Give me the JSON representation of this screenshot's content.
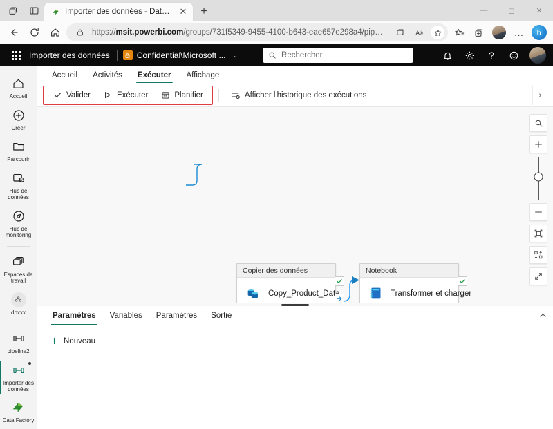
{
  "browser": {
    "tab": {
      "title": "Importer des données - Data Factory",
      "favicon_name": "data-factory-icon",
      "close_label": "✕"
    },
    "newtab_label": "+",
    "window_controls": {
      "minimize": "—",
      "maximize": "◻",
      "close": "✕"
    },
    "nav": {
      "back_label": "←",
      "refresh_label": "⟳",
      "home_label": "⌂",
      "url_prefix": "https://",
      "url_domain": "msit.powerbi.com",
      "url_rest": "/groups/731f5349-9455-4100-b643-eae657e298a4/pip…",
      "read_aloud_label": "A",
      "favorite_label": "☆",
      "favorites_bar_label": "☆",
      "collections_label": "▣",
      "profile_label": "profile",
      "more_label": "…",
      "copilot_label": "b"
    }
  },
  "pbi_header": {
    "waffle_name": "app-launcher",
    "app_title": "Importer des données",
    "sensitivity_label": "Confidential\\Microsoft ...",
    "sensitivity_chevron": "⌄",
    "search_placeholder": "Rechercher",
    "search_icon": "search-icon",
    "icons": {
      "notifications": "bell-icon",
      "settings": "gear-icon",
      "help": "?",
      "feedback": "smiley-icon"
    }
  },
  "rail": {
    "items": [
      {
        "label": "Accueil",
        "icon": "home-icon",
        "selected": false
      },
      {
        "label": "Créer",
        "icon": "plus-circle-icon",
        "selected": false
      },
      {
        "label": "Parcourir",
        "icon": "folder-icon",
        "selected": false
      },
      {
        "label": "Hub de données",
        "icon": "database-icon",
        "selected": false
      },
      {
        "label": "Hub de monitoring",
        "icon": "monitoring-icon",
        "selected": false
      },
      {
        "label": "Espaces de travail",
        "icon": "workspaces-icon",
        "selected": false
      },
      {
        "label": "dpxxx",
        "icon": "workspace-avatar-icon",
        "selected": false
      },
      {
        "label": "pipeline2",
        "icon": "pipeline-icon",
        "selected": false
      },
      {
        "label": "Importer des données",
        "icon": "pipeline-icon",
        "selected": true
      }
    ],
    "footer": {
      "label": "Data Factory",
      "icon": "data-factory-icon"
    }
  },
  "ribbon": {
    "tabs": [
      {
        "label": "Accueil",
        "active": false
      },
      {
        "label": "Activités",
        "active": false
      },
      {
        "label": "Exécuter",
        "active": true
      },
      {
        "label": "Affichage",
        "active": false
      }
    ],
    "group_buttons": [
      {
        "label": "Valider",
        "icon": "checkmark-icon"
      },
      {
        "label": "Exécuter",
        "icon": "play-icon"
      },
      {
        "label": "Planifier",
        "icon": "calendar-icon"
      }
    ],
    "history_button": {
      "label": "Afficher l'historique des exécutions",
      "icon": "run-history-icon"
    },
    "overflow_label": "›",
    "highlight_color": "#e03e3e",
    "accent_color": "#117865"
  },
  "canvas": {
    "nodes": [
      {
        "type_label": "Copier des données",
        "name": "Copy_Product_Data",
        "icon": "copy-data-icon",
        "success_port": "✓",
        "completion_port": "→"
      },
      {
        "type_label": "Notebook",
        "name": "Transformer et charger",
        "icon": "notebook-icon",
        "success_port": "✓"
      }
    ],
    "tools": [
      {
        "name": "zoom-to-search",
        "glyph": "⌕"
      },
      {
        "name": "zoom-in",
        "glyph": "+"
      },
      {
        "name": "zoom-out",
        "glyph": "–"
      },
      {
        "name": "fit-to-screen",
        "glyph": "⤢"
      },
      {
        "name": "auto-layout",
        "glyph": "⇅"
      },
      {
        "name": "collapse-canvas",
        "glyph": "↙"
      }
    ]
  },
  "bottom_panel": {
    "tabs": [
      {
        "label": "Paramètres",
        "active": true
      },
      {
        "label": "Variables",
        "active": false
      },
      {
        "label": "Paramètres",
        "active": false
      },
      {
        "label": "Sortie",
        "active": false
      }
    ],
    "collapse_label": "⌃",
    "new_button": {
      "label": "Nouveau",
      "icon": "plus-icon"
    }
  }
}
